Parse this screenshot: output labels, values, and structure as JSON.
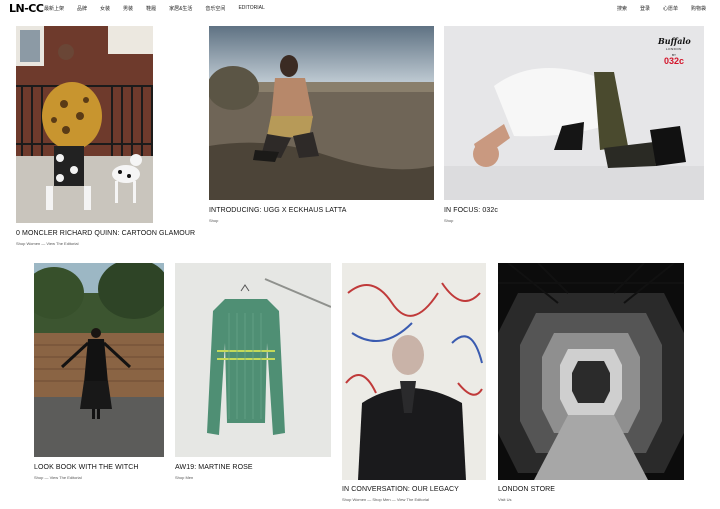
{
  "header": {
    "logo": "LN-CC",
    "nav_left": [
      "最新上架",
      "品牌",
      "女装",
      "男装",
      "鞋履",
      "家居&生活",
      "音乐空间",
      "EDITORIAL"
    ],
    "nav_right": [
      "搜索",
      "登录",
      "心愿单",
      "购物袋"
    ]
  },
  "articles": [
    {
      "title": "0 MONCLER RICHARD QUINN: CARTOON GLAMOUR",
      "links": "Shop Women — View The Editorial"
    },
    {
      "title": "INTRODUCING: UGG X ECKHAUS LATTA",
      "links": "Shop"
    },
    {
      "title": "IN FOCUS: 032c",
      "links": "Shop",
      "image_text": {
        "brand": "Buffalo",
        "city": "LONDON",
        "by": "BY",
        "collab": "032c"
      }
    },
    {
      "title": "LOOK BOOK WITH THE WITCH",
      "links": "Shop — View The Editorial"
    },
    {
      "title": "AW19: MARTINE ROSE",
      "links": "Shop Men"
    },
    {
      "title": "IN CONVERSATION: OUR LEGACY",
      "links": "Shop Women — Shop Men — View The Editorial"
    },
    {
      "title": "LONDON STORE",
      "links": "Visit Us"
    }
  ]
}
